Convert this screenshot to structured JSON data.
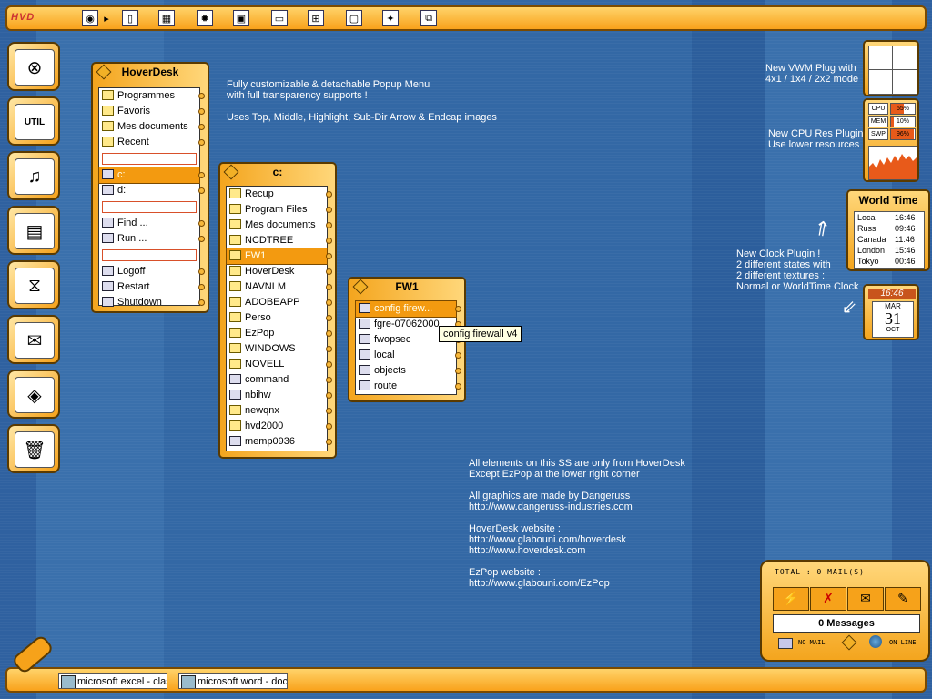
{
  "topbar": {
    "logo": "HVD",
    "icons": [
      "globe-icon",
      "arrow-right-icon",
      "door-icon",
      "spreadsheet-icon",
      "gear-icon",
      "image-icon",
      "display-icon",
      "network-icon",
      "monitor-icon",
      "satellite-icon",
      "windows-icon"
    ]
  },
  "launcher": {
    "items": [
      {
        "name": "hoverdesk-launcher-icon",
        "glyph": "⊗"
      },
      {
        "name": "util-icon",
        "glyph": "UTIL"
      },
      {
        "name": "cd-music-icon",
        "glyph": "♫"
      },
      {
        "name": "documents-icon",
        "glyph": "▤"
      },
      {
        "name": "hourglass-window-icon",
        "glyph": "⧖"
      },
      {
        "name": "mail-letter-icon",
        "glyph": "✉"
      },
      {
        "name": "globe-network-icon",
        "glyph": "◈"
      },
      {
        "name": "recycle-bin-icon",
        "glyph": "🗑"
      }
    ]
  },
  "menus": {
    "hoverdesk": {
      "title": "HoverDesk",
      "items": [
        {
          "label": "Programmes",
          "icon": "folder"
        },
        {
          "label": "Favoris",
          "icon": "folder"
        },
        {
          "label": "Mes documents",
          "icon": "folder"
        },
        {
          "label": "Recent",
          "icon": "folder"
        },
        {
          "sep": true
        },
        {
          "label": "c:",
          "icon": "app",
          "hl": true
        },
        {
          "label": "d:",
          "icon": "app"
        },
        {
          "sep": true
        },
        {
          "label": "Find ...",
          "icon": "app"
        },
        {
          "label": "Run ...",
          "icon": "app"
        },
        {
          "sep": true
        },
        {
          "label": "Logoff",
          "icon": "app"
        },
        {
          "label": "Restart",
          "icon": "app"
        },
        {
          "label": "Shutdown",
          "icon": "app"
        }
      ]
    },
    "c": {
      "title": "c:",
      "items": [
        {
          "label": "Recup",
          "icon": "folder"
        },
        {
          "label": "Program Files",
          "icon": "folder"
        },
        {
          "label": "Mes documents",
          "icon": "folder"
        },
        {
          "label": "NCDTREE",
          "icon": "folder"
        },
        {
          "label": "FW1",
          "icon": "folder",
          "hl": true
        },
        {
          "label": "HoverDesk",
          "icon": "folder"
        },
        {
          "label": "NAVNLM",
          "icon": "folder"
        },
        {
          "label": "ADOBEAPP",
          "icon": "folder"
        },
        {
          "label": "Perso",
          "icon": "folder"
        },
        {
          "label": "EzPop",
          "icon": "folder"
        },
        {
          "label": "WINDOWS",
          "icon": "folder"
        },
        {
          "label": "NOVELL",
          "icon": "folder"
        },
        {
          "label": "command",
          "icon": "app"
        },
        {
          "label": "nbihw",
          "icon": "app"
        },
        {
          "label": "newqnx",
          "icon": "folder"
        },
        {
          "label": "hvd2000",
          "icon": "folder"
        },
        {
          "label": "memp0936",
          "icon": "app"
        }
      ]
    },
    "fw1": {
      "title": "FW1",
      "items": [
        {
          "label": "config firew...",
          "icon": "app",
          "hl": true
        },
        {
          "label": "fgre-07062000",
          "icon": "app"
        },
        {
          "label": "fwopsec",
          "icon": "app"
        },
        {
          "label": "local",
          "icon": "app"
        },
        {
          "label": "objects",
          "icon": "app"
        },
        {
          "label": "route",
          "icon": "app"
        }
      ]
    }
  },
  "tooltip": "config firewall v4",
  "notes": {
    "popup": "Fully customizable & detachable Popup Menu\nwith full transparency supports !\n\nUses Top, Middle, Highlight, Sub-Dir Arrow & Endcap images",
    "credits": "All elements on this SS are only from HoverDesk\nExcept EzPop at the lower right corner\n\nAll graphics are made by Dangeruss\nhttp://www.dangeruss-industries.com\n\nHoverDesk website :\nhttp://www.glabouni.com/hoverdesk\nhttp://www.hoverdesk.com\n\nEzPop website :\nhttp://www.glabouni.com/EzPop",
    "vwm": "New VWM Plug with\n4x1 / 1x4 / 2x2 mode",
    "cpu": "New CPU Res Plugin\nUse lower resources",
    "clock": "New Clock Plugin !\n2 different states with\n2 different textures :\nNormal or WorldTime Clock"
  },
  "cpu_widget": {
    "rows": [
      {
        "label": "CPU",
        "value": "55%",
        "level": 0.55
      },
      {
        "label": "MEM",
        "value": "10%",
        "level": 0.1
      },
      {
        "label": "SWP",
        "value": "96%",
        "level": 0.96
      }
    ]
  },
  "world_time": {
    "title": "World Time",
    "rows": [
      {
        "city": "Local",
        "time": "16:46"
      },
      {
        "city": "Russ",
        "time": "09:46"
      },
      {
        "city": "Canada",
        "time": "11:46"
      },
      {
        "city": "London",
        "time": "15:46"
      },
      {
        "city": "Tokyo",
        "time": "00:46"
      }
    ]
  },
  "clock": {
    "time": "16:46",
    "month": "MAR",
    "day": "31",
    "weekday": "OCT"
  },
  "ezpop": {
    "total": "TOTAL : 0 MAIL(S)",
    "messages": "0 Messages",
    "no_mail": "NO MAIL",
    "on_line": "ON LINE"
  },
  "taskbar": {
    "tasks": [
      {
        "label": "microsoft excel - class"
      },
      {
        "label": "microsoft word - docu"
      }
    ]
  },
  "colors": {
    "accent": "#f4a51e",
    "dark": "#5a3a00",
    "desktop": "#3266a0"
  }
}
